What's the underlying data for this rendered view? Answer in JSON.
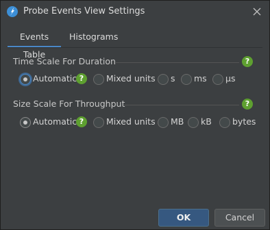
{
  "window": {
    "title": "Probe Events View Settings"
  },
  "tabs": [
    {
      "label": "Events Table",
      "active": true
    },
    {
      "label": "Histograms",
      "active": false
    }
  ],
  "time_scale": {
    "title": "Time Scale For Duration",
    "options": [
      "Automatic",
      "Mixed units",
      "s",
      "ms",
      "μs"
    ],
    "selected": "Automatic"
  },
  "size_scale": {
    "title": "Size Scale For Throughput",
    "options": [
      "Automatic",
      "Mixed units",
      "MB",
      "kB",
      "bytes"
    ],
    "selected": "Automatic"
  },
  "help_glyph": "?",
  "buttons": {
    "ok": "OK",
    "cancel": "Cancel"
  },
  "colors": {
    "accent": "#4a88c7",
    "help": "#5ea030",
    "background": "#3c3f41"
  },
  "icons": {
    "app": "probe-app-icon",
    "close": "close-icon",
    "help": "help-icon"
  }
}
